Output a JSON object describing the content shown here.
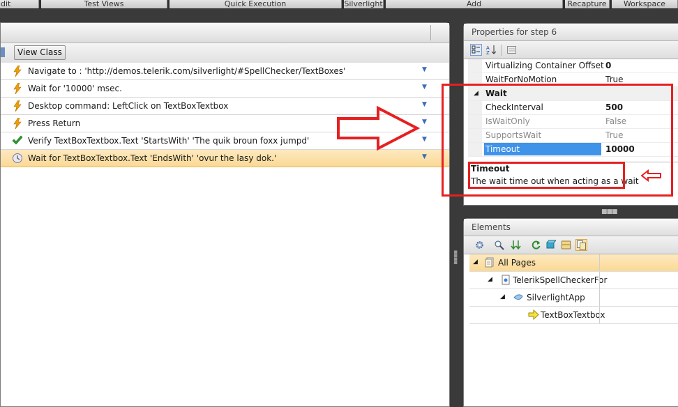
{
  "ribbon": {
    "groups": [
      "dit",
      "Test Views",
      "Quick Execution",
      "Silverlight",
      "Add",
      "Recapture",
      "Workspace"
    ]
  },
  "steps_panel": {
    "view_class_label": "View Class",
    "steps": [
      {
        "text": "Navigate to : 'http://demos.telerik.com/silverlight/#SpellChecker/TextBoxes'",
        "icon": "lightning-icon"
      },
      {
        "text": "Wait for '10000' msec.",
        "icon": "lightning-icon"
      },
      {
        "text": "Desktop command: LeftClick on TextBoxTextbox",
        "icon": "lightning-icon"
      },
      {
        "text": "Press Return",
        "icon": "lightning-icon"
      },
      {
        "text": "Verify TextBoxTextbox.Text 'StartsWith' 'The quik broun foxx jumpd'",
        "icon": "checkmark-icon"
      },
      {
        "text": "Wait for TextBoxTextbox.Text 'EndsWith' 'ovur the lasy dok.'",
        "icon": "clock-icon",
        "selected": true
      }
    ]
  },
  "properties": {
    "title": "Properties for step 6",
    "rows": [
      {
        "name": "Virtualizing Container Offset",
        "value": "0",
        "style": "bold"
      },
      {
        "name": "WaitForNoMotion",
        "value": "True",
        "style": "normal"
      },
      {
        "category": "Wait"
      },
      {
        "name": "CheckInterval",
        "value": "500",
        "style": "bold"
      },
      {
        "name": "IsWaitOnly",
        "value": "False",
        "style": "gray"
      },
      {
        "name": "SupportsWait",
        "value": "True",
        "style": "gray"
      },
      {
        "name": "Timeout",
        "value": "10000",
        "style": "bold",
        "highlight": true
      }
    ],
    "description": {
      "title": "Timeout",
      "text": "The wait time out when acting as a wait"
    }
  },
  "elements": {
    "title": "Elements",
    "tree": [
      {
        "label": "All Pages",
        "level": 0,
        "icon": "pages-icon",
        "expanded": true,
        "selected": true
      },
      {
        "label": "TelerikSpellCheckerFor",
        "level": 1,
        "icon": "page-icon",
        "expanded": true
      },
      {
        "label": "SilverlightApp",
        "level": 2,
        "icon": "silverlight-icon",
        "expanded": true
      },
      {
        "label": "TextBoxTextbox",
        "level": 3,
        "icon": "arrow-right-icon"
      }
    ]
  },
  "colors": {
    "annotation_red": "#e62020",
    "selection_orange": "#fbd995",
    "highlight_blue": "#3f93e8"
  }
}
